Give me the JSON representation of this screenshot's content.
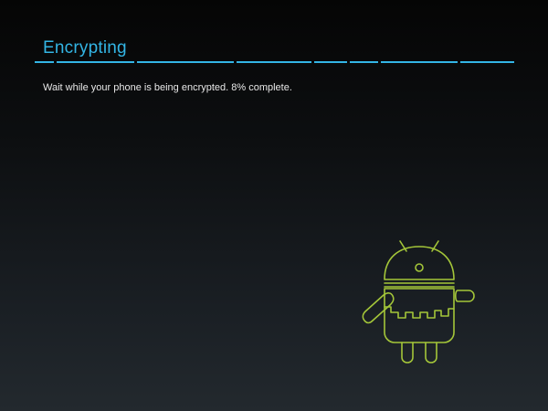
{
  "header": {
    "title": "Encrypting"
  },
  "progress": {
    "message": "Wait while your phone is being encrypted. 8% complete.",
    "percent_complete": 8
  },
  "colors": {
    "accent": "#33b5e5",
    "android_outline": "#a4c639",
    "text": "#e8e8e8"
  },
  "icons": {
    "mascot": "android-robot-wireframe-icon"
  }
}
